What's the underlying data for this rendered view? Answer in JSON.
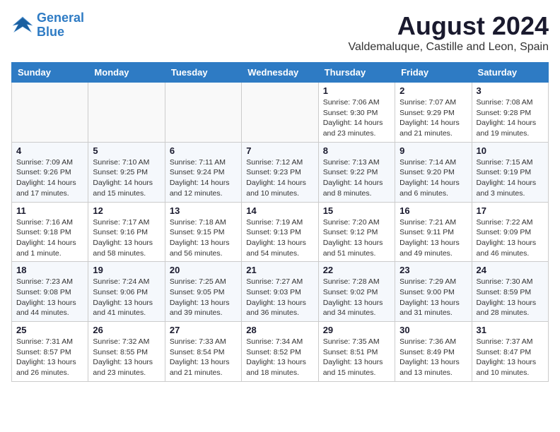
{
  "logo": {
    "line1": "General",
    "line2": "Blue"
  },
  "title": "August 2024",
  "location": "Valdemaluque, Castille and Leon, Spain",
  "weekdays": [
    "Sunday",
    "Monday",
    "Tuesday",
    "Wednesday",
    "Thursday",
    "Friday",
    "Saturday"
  ],
  "weeks": [
    [
      {
        "day": "",
        "info": ""
      },
      {
        "day": "",
        "info": ""
      },
      {
        "day": "",
        "info": ""
      },
      {
        "day": "",
        "info": ""
      },
      {
        "day": "1",
        "info": "Sunrise: 7:06 AM\nSunset: 9:30 PM\nDaylight: 14 hours\nand 23 minutes."
      },
      {
        "day": "2",
        "info": "Sunrise: 7:07 AM\nSunset: 9:29 PM\nDaylight: 14 hours\nand 21 minutes."
      },
      {
        "day": "3",
        "info": "Sunrise: 7:08 AM\nSunset: 9:28 PM\nDaylight: 14 hours\nand 19 minutes."
      }
    ],
    [
      {
        "day": "4",
        "info": "Sunrise: 7:09 AM\nSunset: 9:26 PM\nDaylight: 14 hours\nand 17 minutes."
      },
      {
        "day": "5",
        "info": "Sunrise: 7:10 AM\nSunset: 9:25 PM\nDaylight: 14 hours\nand 15 minutes."
      },
      {
        "day": "6",
        "info": "Sunrise: 7:11 AM\nSunset: 9:24 PM\nDaylight: 14 hours\nand 12 minutes."
      },
      {
        "day": "7",
        "info": "Sunrise: 7:12 AM\nSunset: 9:23 PM\nDaylight: 14 hours\nand 10 minutes."
      },
      {
        "day": "8",
        "info": "Sunrise: 7:13 AM\nSunset: 9:22 PM\nDaylight: 14 hours\nand 8 minutes."
      },
      {
        "day": "9",
        "info": "Sunrise: 7:14 AM\nSunset: 9:20 PM\nDaylight: 14 hours\nand 6 minutes."
      },
      {
        "day": "10",
        "info": "Sunrise: 7:15 AM\nSunset: 9:19 PM\nDaylight: 14 hours\nand 3 minutes."
      }
    ],
    [
      {
        "day": "11",
        "info": "Sunrise: 7:16 AM\nSunset: 9:18 PM\nDaylight: 14 hours\nand 1 minute."
      },
      {
        "day": "12",
        "info": "Sunrise: 7:17 AM\nSunset: 9:16 PM\nDaylight: 13 hours\nand 58 minutes."
      },
      {
        "day": "13",
        "info": "Sunrise: 7:18 AM\nSunset: 9:15 PM\nDaylight: 13 hours\nand 56 minutes."
      },
      {
        "day": "14",
        "info": "Sunrise: 7:19 AM\nSunset: 9:13 PM\nDaylight: 13 hours\nand 54 minutes."
      },
      {
        "day": "15",
        "info": "Sunrise: 7:20 AM\nSunset: 9:12 PM\nDaylight: 13 hours\nand 51 minutes."
      },
      {
        "day": "16",
        "info": "Sunrise: 7:21 AM\nSunset: 9:11 PM\nDaylight: 13 hours\nand 49 minutes."
      },
      {
        "day": "17",
        "info": "Sunrise: 7:22 AM\nSunset: 9:09 PM\nDaylight: 13 hours\nand 46 minutes."
      }
    ],
    [
      {
        "day": "18",
        "info": "Sunrise: 7:23 AM\nSunset: 9:08 PM\nDaylight: 13 hours\nand 44 minutes."
      },
      {
        "day": "19",
        "info": "Sunrise: 7:24 AM\nSunset: 9:06 PM\nDaylight: 13 hours\nand 41 minutes."
      },
      {
        "day": "20",
        "info": "Sunrise: 7:25 AM\nSunset: 9:05 PM\nDaylight: 13 hours\nand 39 minutes."
      },
      {
        "day": "21",
        "info": "Sunrise: 7:27 AM\nSunset: 9:03 PM\nDaylight: 13 hours\nand 36 minutes."
      },
      {
        "day": "22",
        "info": "Sunrise: 7:28 AM\nSunset: 9:02 PM\nDaylight: 13 hours\nand 34 minutes."
      },
      {
        "day": "23",
        "info": "Sunrise: 7:29 AM\nSunset: 9:00 PM\nDaylight: 13 hours\nand 31 minutes."
      },
      {
        "day": "24",
        "info": "Sunrise: 7:30 AM\nSunset: 8:59 PM\nDaylight: 13 hours\nand 28 minutes."
      }
    ],
    [
      {
        "day": "25",
        "info": "Sunrise: 7:31 AM\nSunset: 8:57 PM\nDaylight: 13 hours\nand 26 minutes."
      },
      {
        "day": "26",
        "info": "Sunrise: 7:32 AM\nSunset: 8:55 PM\nDaylight: 13 hours\nand 23 minutes."
      },
      {
        "day": "27",
        "info": "Sunrise: 7:33 AM\nSunset: 8:54 PM\nDaylight: 13 hours\nand 21 minutes."
      },
      {
        "day": "28",
        "info": "Sunrise: 7:34 AM\nSunset: 8:52 PM\nDaylight: 13 hours\nand 18 minutes."
      },
      {
        "day": "29",
        "info": "Sunrise: 7:35 AM\nSunset: 8:51 PM\nDaylight: 13 hours\nand 15 minutes."
      },
      {
        "day": "30",
        "info": "Sunrise: 7:36 AM\nSunset: 8:49 PM\nDaylight: 13 hours\nand 13 minutes."
      },
      {
        "day": "31",
        "info": "Sunrise: 7:37 AM\nSunset: 8:47 PM\nDaylight: 13 hours\nand 10 minutes."
      }
    ]
  ]
}
